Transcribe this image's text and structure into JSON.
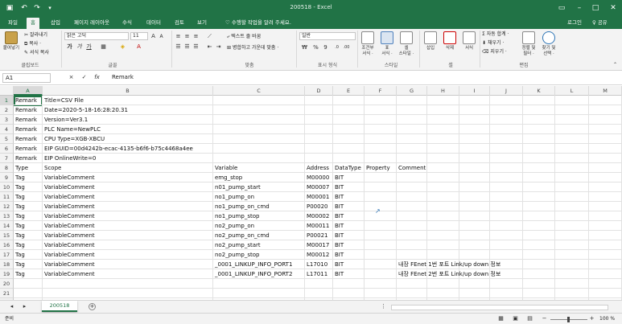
{
  "window": {
    "title": "200518 - Excel"
  },
  "qat": {
    "save_icon": "save-icon",
    "undo_icon": "undo-icon",
    "redo_icon": "redo-icon"
  },
  "tabs": [
    "파일",
    "홈",
    "삽입",
    "페이지 레이아웃",
    "수식",
    "데이터",
    "검토",
    "보기"
  ],
  "active_tab": "홈",
  "tellme": "♡ 수행할 작업을 알려 주세요.",
  "account": {
    "login": "로그인",
    "share": "♀ 공유"
  },
  "ribbon": {
    "clipboard": {
      "paste": "붙여넣기",
      "cut": "잘라내기",
      "copy": "복사 ·",
      "format_painter": "서식 복사",
      "label": "클립보드"
    },
    "font": {
      "name": "맑은 고딕",
      "size": "11",
      "bold": "가",
      "italic": "가",
      "underline": "가",
      "label": "글꼴"
    },
    "alignment": {
      "wrap": "텍스트 줄 바꿈",
      "merge": "병합하고 가운데 맞춤 ·",
      "label": "맞춤"
    },
    "number": {
      "format": "일반",
      "percent": "%",
      "comma": "9",
      "label": "표시 형식"
    },
    "styles": {
      "conditional": "조건부\n서식 ·",
      "table": "표\n서식 ·",
      "cell": "셀\n스타일 ·",
      "label": "스타일"
    },
    "cells": {
      "insert": "삽입",
      "delete": "삭제",
      "format": "서식",
      "label": "셀"
    },
    "editing": {
      "autosum": "Σ 자동 합계 ·",
      "fill": "채우기 ·",
      "clear": "지우기 ·",
      "sort": "정렬 및\n필터 ·",
      "find": "찾기 및\n선택 ·",
      "label": "편집"
    }
  },
  "formula": {
    "namebox": "A1",
    "cancel": "×",
    "enter": "✓",
    "fx": "fx",
    "value": "Remark"
  },
  "columns": [
    "A",
    "B",
    "C",
    "D",
    "E",
    "F",
    "G",
    "H",
    "I",
    "J",
    "K",
    "L",
    "M"
  ],
  "rows": [
    [
      "Remark",
      "Title=CSV File",
      "",
      "",
      "",
      "",
      "",
      "",
      "",
      "",
      "",
      "",
      ""
    ],
    [
      "Remark",
      "Date=2020-5-18-16:28:20.31",
      "",
      "",
      "",
      "",
      "",
      "",
      "",
      "",
      "",
      "",
      ""
    ],
    [
      "Remark",
      "Version=Ver3.1",
      "",
      "",
      "",
      "",
      "",
      "",
      "",
      "",
      "",
      "",
      ""
    ],
    [
      "Remark",
      "PLC Name=NewPLC",
      "",
      "",
      "",
      "",
      "",
      "",
      "",
      "",
      "",
      "",
      ""
    ],
    [
      "Remark",
      "CPU Type=XGB-XBCU",
      "",
      "",
      "",
      "",
      "",
      "",
      "",
      "",
      "",
      "",
      ""
    ],
    [
      "Remark",
      "EIP GUID=00d4242b-ecac-4135-b6f6-b75c4468a4ee",
      "",
      "",
      "",
      "",
      "",
      "",
      "",
      "",
      "",
      "",
      ""
    ],
    [
      "Remark",
      "EIP OnlineWrite=0",
      "",
      "",
      "",
      "",
      "",
      "",
      "",
      "",
      "",
      "",
      ""
    ],
    [
      "Type",
      "Scope",
      "Variable",
      "Address",
      "DataType",
      "Property",
      "Comment",
      "",
      "",
      "",
      "",
      "",
      ""
    ],
    [
      "Tag",
      "VariableComment",
      "emg_stop",
      "M00000",
      "BIT",
      "",
      "",
      "",
      "",
      "",
      "",
      "",
      ""
    ],
    [
      "Tag",
      "VariableComment",
      "n01_pump_start",
      "M00007",
      "BIT",
      "",
      "",
      "",
      "",
      "",
      "",
      "",
      ""
    ],
    [
      "Tag",
      "VariableComment",
      "no1_pump_on",
      "M00001",
      "BIT",
      "",
      "",
      "",
      "",
      "",
      "",
      "",
      ""
    ],
    [
      "Tag",
      "VariableComment",
      "no1_pump_on_cmd",
      "P00020",
      "BIT",
      "",
      "",
      "",
      "",
      "",
      "",
      "",
      ""
    ],
    [
      "Tag",
      "VariableComment",
      "no1_pump_stop",
      "M00002",
      "BIT",
      "",
      "",
      "",
      "",
      "",
      "",
      "",
      ""
    ],
    [
      "Tag",
      "VariableComment",
      "no2_pump_on",
      "M00011",
      "BIT",
      "",
      "",
      "",
      "",
      "",
      "",
      "",
      ""
    ],
    [
      "Tag",
      "VariableComment",
      "no2_pump_on_cmd",
      "P00021",
      "BIT",
      "",
      "",
      "",
      "",
      "",
      "",
      "",
      ""
    ],
    [
      "Tag",
      "VariableComment",
      "no2_pump_start",
      "M00017",
      "BIT",
      "",
      "",
      "",
      "",
      "",
      "",
      "",
      ""
    ],
    [
      "Tag",
      "VariableComment",
      "no2_pump_stop",
      "M00012",
      "BIT",
      "",
      "",
      "",
      "",
      "",
      "",
      "",
      ""
    ],
    [
      "Tag",
      "VariableComment",
      "_0001_LINKUP_INFO_PORT1",
      "L17010",
      "BIT",
      "",
      "내장 FEnet 1번 포트 Link/up down 정보",
      "",
      "",
      "",
      "",
      "",
      ""
    ],
    [
      "Tag",
      "VariableComment",
      "_0001_LINKUP_INFO_PORT2",
      "L17011",
      "BIT",
      "",
      "내장 FEnet 2번 포트 Link/up down 정보",
      "",
      "",
      "",
      "",
      "",
      ""
    ],
    [
      "",
      "",
      "",
      "",
      "",
      "",
      "",
      "",
      "",
      "",
      "",
      "",
      ""
    ],
    [
      "",
      "",
      "",
      "",
      "",
      "",
      "",
      "",
      "",
      "",
      "",
      "",
      ""
    ],
    [
      "",
      "",
      "",
      "",
      "",
      "",
      "",
      "",
      "",
      "",
      "",
      "",
      ""
    ]
  ],
  "sheet": {
    "name": "200518",
    "add": "+"
  },
  "status": {
    "mode": "준비",
    "zoom": "100 %"
  },
  "colors": {
    "excel_green": "#217346",
    "ribbon_bg": "#f3f3f3"
  }
}
